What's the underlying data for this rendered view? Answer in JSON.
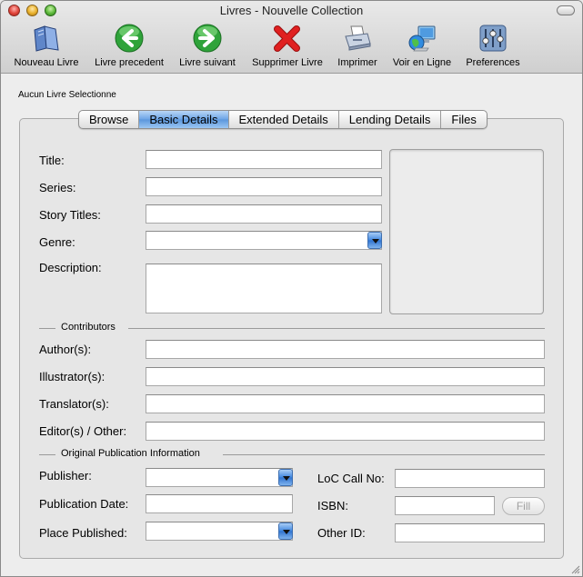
{
  "window": {
    "title": "Livres - Nouvelle Collection"
  },
  "toolbar": {
    "items": [
      {
        "label": "Nouveau Livre",
        "icon": "book-icon"
      },
      {
        "label": "Livre precedent",
        "icon": "arrow-left-icon"
      },
      {
        "label": "Livre suivant",
        "icon": "arrow-right-icon"
      },
      {
        "label": "Supprimer Livre",
        "icon": "delete-x-icon"
      },
      {
        "label": "Imprimer",
        "icon": "printer-icon"
      },
      {
        "label": "Voir en Ligne",
        "icon": "globe-computer-icon"
      },
      {
        "label": "Preferences",
        "icon": "preferences-sliders-icon"
      }
    ]
  },
  "status": {
    "selection": "Aucun Livre Selectionne"
  },
  "tabs": [
    {
      "label": "Browse"
    },
    {
      "label": "Basic Details",
      "active": true
    },
    {
      "label": "Extended Details"
    },
    {
      "label": "Lending Details"
    },
    {
      "label": "Files"
    }
  ],
  "basic": {
    "title_label": "Title:",
    "series_label": "Series:",
    "story_titles_label": "Story Titles:",
    "genre_label": "Genre:",
    "description_label": "Description:"
  },
  "contributors": {
    "heading": "Contributors",
    "authors_label": "Author(s):",
    "illustrators_label": "Illustrator(s):",
    "translators_label": "Translator(s):",
    "editors_label": "Editor(s) / Other:"
  },
  "publication": {
    "heading": "Original Publication Information",
    "publisher_label": "Publisher:",
    "pub_date_label": "Publication Date:",
    "place_label": "Place Published:",
    "loc_label": "LoC Call No:",
    "isbn_label": "ISBN:",
    "other_id_label": "Other ID:",
    "fill_label": "Fill"
  },
  "colors": {
    "accent": "#5a96dc",
    "green_button": "#2fa33a",
    "delete_red": "#e02020"
  }
}
